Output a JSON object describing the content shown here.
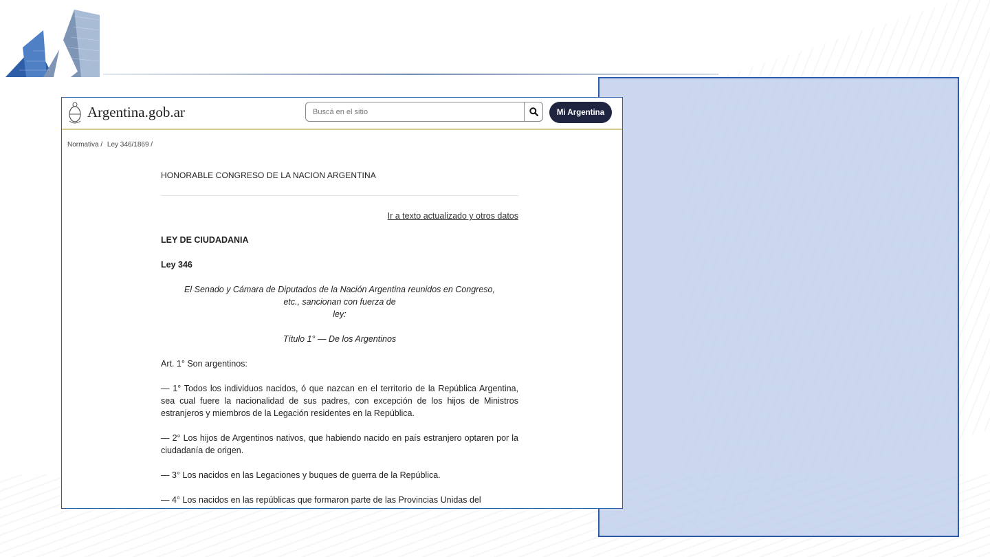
{
  "site": {
    "title": "Argentina.gob.ar",
    "search_placeholder": "Buscá en el sitio",
    "mi_argentina_label": "Mi Argentina"
  },
  "breadcrumb": [
    "Normativa /",
    "Ley 346/1869 /"
  ],
  "document": {
    "issuer": "HONORABLE CONGRESO DE LA NACION ARGENTINA",
    "updated_link": "Ir a texto actualizado y otros datos",
    "law_title": "LEY DE CIUDADANIA",
    "law_number": "Ley 346",
    "preamble_line1": "El Senado y Cámara de Diputados de la Nación Argentina reunidos en Congreso,",
    "preamble_line2": "etc., sancionan con fuerza de",
    "preamble_line3": "ley:",
    "titulo": "Título 1° — De los Argentinos",
    "article": "Art. 1° Son argentinos:",
    "paragraphs": [
      "— 1° Todos los individuos nacidos, ó que nazcan en el territorio de la República Argentina, sea cual fuere la nacionalidad de sus padres, con excepción de los hijos de Ministros estranjeros y miembros de la Legación residentes en la República.",
      "— 2° Los hijos de Argentinos nativos, que habiendo nacido en país estranjero optaren por la ciudadanía de origen.",
      "— 3° Los nacidos en las Legaciones y buques de guerra de la República.",
      "— 4° Los nacidos en las repúblicas que formaron parte de las Provincias Unidas del"
    ]
  },
  "colors": {
    "panel_fill": "#becfea",
    "panel_border": "#2c5aa8",
    "button_dark": "#1f2540",
    "header_rule": "#d6c98a"
  },
  "icons": [
    "building-logo-icon",
    "coat-of-arms-icon",
    "search-icon"
  ]
}
